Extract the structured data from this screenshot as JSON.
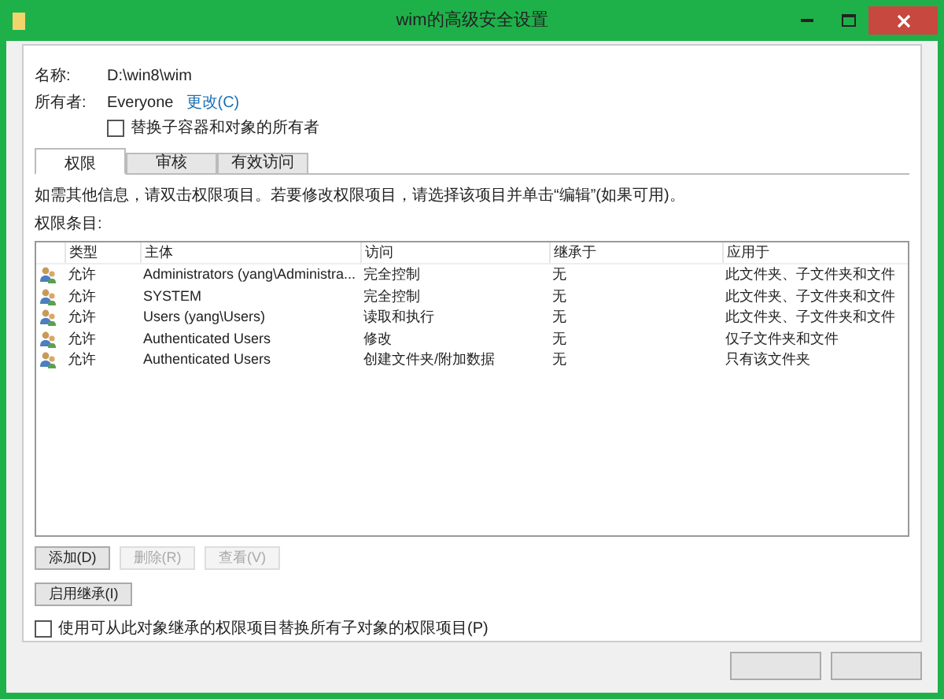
{
  "window": {
    "title": "wim的高级安全设置"
  },
  "name": {
    "label": "名称:",
    "value": "D:\\win8\\wim"
  },
  "owner": {
    "label": "所有者:",
    "value": "Everyone",
    "link": "更改(C)"
  },
  "replace_owner": {
    "label": "替换子容器和对象的所有者",
    "checked": false
  },
  "tabs": [
    {
      "label": "权限",
      "selected": true
    },
    {
      "label": "审核",
      "selected": false
    },
    {
      "label": "有效访问",
      "selected": false
    }
  ],
  "info": "如需其他信息，请双击权限项目。若要修改权限项目，请选择该项目并单击“编辑”(如果可用)。",
  "entries_label": "权限条目:",
  "table": {
    "columns": [
      "类型",
      "主体",
      "访问",
      "继承于",
      "应用于"
    ],
    "rows": [
      {
        "cells": [
          "允许",
          "Administrators (yang\\Administra...",
          "完全控制",
          "无",
          "此文件夹、子文件夹和文件"
        ]
      },
      {
        "cells": [
          "允许",
          "SYSTEM",
          "完全控制",
          "无",
          "此文件夹、子文件夹和文件"
        ]
      },
      {
        "cells": [
          "允许",
          "Users (yang\\Users)",
          "读取和执行",
          "无",
          "此文件夹、子文件夹和文件"
        ]
      },
      {
        "cells": [
          "允许",
          "Authenticated Users",
          "修改",
          "无",
          "仅子文件夹和文件"
        ]
      },
      {
        "cells": [
          "允许",
          "Authenticated Users",
          "创建文件夹/附加数据",
          "无",
          "只有该文件夹"
        ]
      }
    ]
  },
  "buttons": [
    {
      "label": "添加(D)",
      "disabled": false
    },
    {
      "label": "删除(R)",
      "disabled": true
    },
    {
      "label": "查看(V)",
      "disabled": true
    }
  ],
  "inheritance_button": "启用继承(I)",
  "replace_children": {
    "label": "使用可从此对象继承的权限项目替换所有子对象的权限项目(P)",
    "checked": false
  }
}
